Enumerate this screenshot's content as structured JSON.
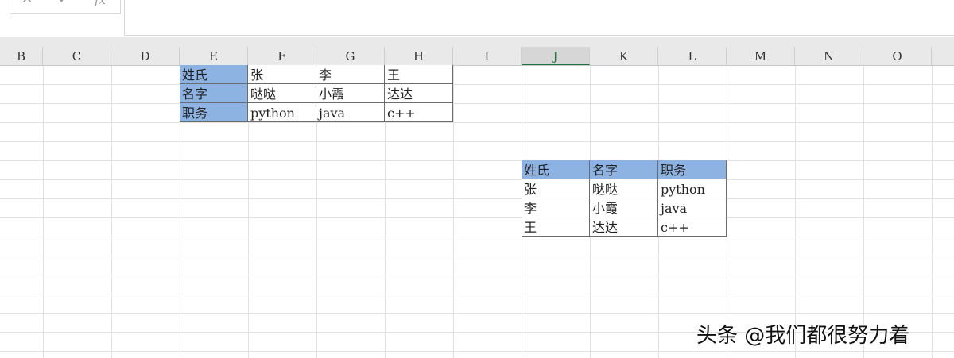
{
  "formula_bar": {
    "cancel_icon": "✕",
    "confirm_icon": "✓",
    "fx_label": "fx",
    "value": ""
  },
  "columns": [
    "B",
    "C",
    "D",
    "E",
    "F",
    "G",
    "H",
    "I",
    "J",
    "K",
    "L",
    "M",
    "N",
    "O"
  ],
  "active_column": "J",
  "table1": {
    "rows": [
      {
        "header": "姓氏",
        "values": [
          "张",
          "李",
          "王"
        ]
      },
      {
        "header": "名字",
        "values": [
          "哒哒",
          "小霞",
          "达达"
        ]
      },
      {
        "header": "职务",
        "values": [
          "python",
          "java",
          "c++"
        ]
      }
    ]
  },
  "table2": {
    "headers": [
      "姓氏",
      "名字",
      "职务"
    ],
    "rows": [
      [
        "张",
        "哒哒",
        "python"
      ],
      [
        "李",
        "小霞",
        "java"
      ],
      [
        "王",
        "达达",
        "c++"
      ]
    ]
  },
  "watermark": "头条 @我们都很努力着",
  "colors": {
    "header_fill": "#8db3e2",
    "active_column": "#217346",
    "grid": "#e2e2e2"
  }
}
